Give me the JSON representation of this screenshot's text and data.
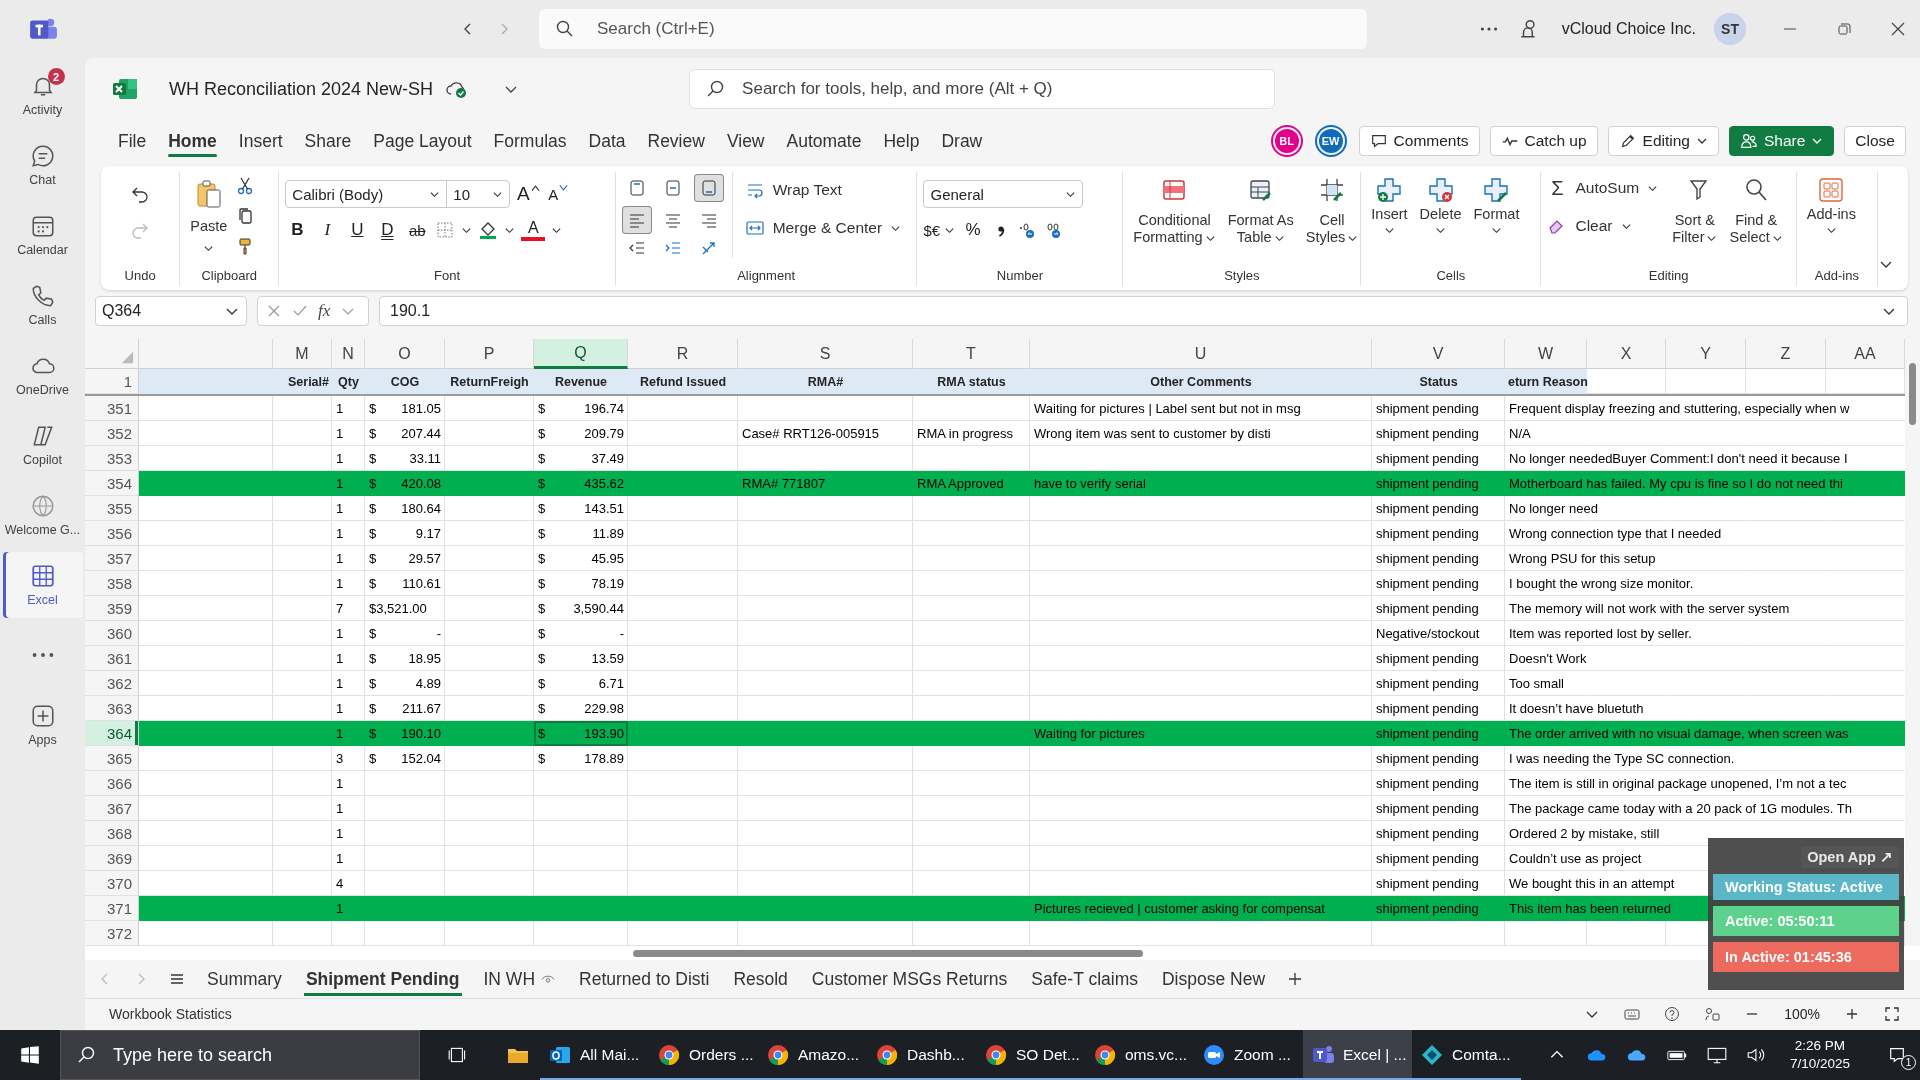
{
  "teams_bar": {
    "search_placeholder": "Search (Ctrl+E)",
    "organization": "vCloud Choice Inc.",
    "user_initials": "ST"
  },
  "rail": [
    {
      "kind": "activity",
      "label": "Activity",
      "badge": "2",
      "selected": false
    },
    {
      "kind": "chat",
      "label": "Chat",
      "selected": false
    },
    {
      "kind": "calendar",
      "label": "Calendar",
      "selected": false
    },
    {
      "kind": "calls",
      "label": "Calls",
      "selected": false
    },
    {
      "kind": "onedrive",
      "label": "OneDrive",
      "selected": false
    },
    {
      "kind": "copilot",
      "label": "Copilot",
      "selected": false
    },
    {
      "kind": "welcome",
      "label": "Welcome G...",
      "selected": false
    },
    {
      "kind": "excel",
      "label": "Excel",
      "selected": true
    },
    {
      "kind": "more",
      "selected": false
    },
    {
      "kind": "apps",
      "label": "Apps",
      "selected": false
    }
  ],
  "workbook": {
    "title": "WH Reconciliation 2024 New-SH",
    "search_placeholder": "Search for tools, help, and more (Alt + Q)"
  },
  "menu_tabs": [
    {
      "label": "File",
      "selected": false
    },
    {
      "label": "Home",
      "selected": true
    },
    {
      "label": "Insert",
      "selected": false
    },
    {
      "label": "Share",
      "selected": false
    },
    {
      "label": "Page Layout",
      "selected": false
    },
    {
      "label": "Formulas",
      "selected": false
    },
    {
      "label": "Data",
      "selected": false
    },
    {
      "label": "Review",
      "selected": false
    },
    {
      "label": "View",
      "selected": false
    },
    {
      "label": "Automate",
      "selected": false
    },
    {
      "label": "Help",
      "selected": false
    },
    {
      "label": "Draw",
      "selected": false
    }
  ],
  "collaborators": [
    {
      "initials": "BL",
      "color": "#e3008c"
    },
    {
      "initials": "EW",
      "color": "#0f6cbd"
    }
  ],
  "actions": [
    {
      "kind": "comments",
      "label": "Comments"
    },
    {
      "kind": "catchup",
      "label": "Catch up"
    },
    {
      "kind": "editing",
      "label": "Editing"
    },
    {
      "kind": "share",
      "label": "Share"
    },
    {
      "kind": "close",
      "label": "Close"
    }
  ],
  "ribbon": {
    "undo_label": "Undo",
    "clipboard": {
      "label": "Clipboard",
      "paste": "Paste"
    },
    "font": {
      "label": "Font",
      "name": "Calibri (Body)",
      "size": "10",
      "grow": "A",
      "shrink": "A",
      "color_letter": "A",
      "styles": [
        {
          "kind": "bold",
          "text": "B"
        },
        {
          "kind": "italic",
          "text": "I"
        },
        {
          "kind": "underline",
          "text": "U"
        },
        {
          "kind": "double_underline",
          "text": "D"
        },
        {
          "kind": "strike",
          "text": "ab"
        }
      ]
    },
    "alignment": {
      "label": "Alignment",
      "vertical": [
        {
          "kind": "top",
          "selected": false
        },
        {
          "kind": "middle",
          "selected": false
        },
        {
          "kind": "bottom",
          "selected": true
        }
      ],
      "horizontal": [
        {
          "kind": "left",
          "selected": true
        },
        {
          "kind": "center",
          "selected": false
        },
        {
          "kind": "right",
          "selected": false
        }
      ],
      "wrap": "Wrap Text",
      "merge": "Merge & Center"
    },
    "number": {
      "label": "Number",
      "format": "General",
      "currency": "$€",
      "percent": "%"
    },
    "styles": {
      "label": "Styles",
      "buttons": [
        {
          "kind": "conditional",
          "lines": [
            "Conditional",
            "Formatting"
          ]
        },
        {
          "kind": "table",
          "lines": [
            "Format As",
            "Table"
          ]
        },
        {
          "kind": "cell_styles",
          "lines": [
            "Cell",
            "Styles"
          ]
        }
      ]
    },
    "cells": {
      "label": "Cells",
      "buttons": [
        {
          "kind": "insert",
          "label": "Insert"
        },
        {
          "kind": "delete",
          "label": "Delete"
        },
        {
          "kind": "format",
          "label": "Format"
        }
      ]
    },
    "editing": {
      "label": "Editing",
      "sigma": "Σ",
      "autosum": "AutoSum",
      "clear": "Clear",
      "buttons": [
        {
          "kind": "sort",
          "lines": [
            "Sort &",
            "Filter"
          ]
        },
        {
          "kind": "find",
          "lines": [
            "Find &",
            "Select"
          ]
        }
      ]
    },
    "addins": {
      "label": "Add-ins",
      "button": "Add-ins"
    }
  },
  "formula_bar": {
    "cell": "Q364",
    "function_label": "fx",
    "formula": "190.1"
  },
  "sheet": {
    "columns": [
      {
        "letter": "M",
        "selected": false
      },
      {
        "letter": "N",
        "selected": false
      },
      {
        "letter": "O",
        "selected": false
      },
      {
        "letter": "P",
        "selected": false
      },
      {
        "letter": "Q",
        "selected": true
      },
      {
        "letter": "R",
        "selected": false
      },
      {
        "letter": "S",
        "selected": false
      },
      {
        "letter": "T",
        "selected": false
      },
      {
        "letter": "U",
        "selected": false
      },
      {
        "letter": "V",
        "selected": false
      },
      {
        "letter": "W",
        "selected": false
      },
      {
        "letter": "X",
        "selected": false
      },
      {
        "letter": "Y",
        "selected": false
      },
      {
        "letter": "Z",
        "selected": false
      },
      {
        "letter": "AA",
        "selected": false
      }
    ],
    "header_row": {
      "number": "1",
      "cells": [
        "Serial#",
        "Qty",
        "COG",
        "ReturnFreigh",
        "Revenue",
        "Refund Issued",
        "RMA#",
        "RMA status",
        "Other Comments",
        "Status",
        "eturn Reason"
      ]
    },
    "rows": [
      {
        "number": "351",
        "selected": false,
        "highlight": false,
        "qty": "1",
        "cog_symbol": "$",
        "cog": "181.05",
        "revenue_symbol": "$",
        "revenue": "196.74",
        "comment": "Waiting for pictures | Label sent but not in msg",
        "status": "shipment pending",
        "reason": "Frequent display freezing and stuttering, especially when w"
      },
      {
        "number": "352",
        "selected": false,
        "highlight": false,
        "qty": "1",
        "cog_symbol": "$",
        "cog": "207.44",
        "revenue_symbol": "$",
        "revenue": "209.79",
        "rma": "Case# RRT126-005915",
        "rma_status": "RMA in progress",
        "comment": "Wrong item was sent to customer by disti",
        "status": "shipment pending",
        "reason": "N/A"
      },
      {
        "number": "353",
        "selected": false,
        "highlight": false,
        "qty": "1",
        "cog_symbol": "$",
        "cog": "33.11",
        "revenue_symbol": "$",
        "revenue": "37.49",
        "status": "shipment pending",
        "reason": "No longer neededBuyer Comment:I don't need it because I"
      },
      {
        "number": "354",
        "selected": false,
        "highlight": true,
        "qty": "1",
        "cog_symbol": "$",
        "cog": "420.08",
        "revenue_symbol": "$",
        "revenue": "435.62",
        "rma": "RMA# 771807",
        "rma_status": "RMA Approved",
        "comment": "have to verify serial",
        "status": "shipment pending",
        "reason": "Motherboard has failed. My cpu is fine so I do not need thi"
      },
      {
        "number": "355",
        "selected": false,
        "highlight": false,
        "qty": "1",
        "cog_symbol": "$",
        "cog": "180.64",
        "revenue_symbol": "$",
        "revenue": "143.51",
        "status": "shipment pending",
        "reason": "No longer need"
      },
      {
        "number": "356",
        "selected": false,
        "highlight": false,
        "qty": "1",
        "cog_symbol": "$",
        "cog": "9.17",
        "revenue_symbol": "$",
        "revenue": "11.89",
        "status": "shipment pending",
        "reason": "Wrong connection type that I needed"
      },
      {
        "number": "357",
        "selected": false,
        "highlight": false,
        "qty": "1",
        "cog_symbol": "$",
        "cog": "29.57",
        "revenue_symbol": "$",
        "revenue": "45.95",
        "status": "shipment pending",
        "reason": "Wrong PSU for this setup"
      },
      {
        "number": "358",
        "selected": false,
        "highlight": false,
        "qty": "1",
        "cog_symbol": "$",
        "cog": "110.61",
        "revenue_symbol": "$",
        "revenue": "78.19",
        "status": "shipment pending",
        "reason": "I bought the wrong size monitor."
      },
      {
        "number": "359",
        "selected": false,
        "highlight": false,
        "qty": "7",
        "cog": "$3,521.00",
        "revenue_symbol": "$",
        "revenue": "3,590.44",
        "status": "shipment pending",
        "reason": "The memory will not work with the server system"
      },
      {
        "number": "360",
        "selected": false,
        "highlight": false,
        "qty": "1",
        "cog_symbol": "$",
        "cog": "-",
        "revenue_symbol": "$",
        "revenue": "-",
        "status": "Negative/stockout",
        "reason": "Item was reported lost by seller."
      },
      {
        "number": "361",
        "selected": false,
        "highlight": false,
        "qty": "1",
        "cog_symbol": "$",
        "cog": "18.95",
        "revenue_symbol": "$",
        "revenue": "13.59",
        "status": "shipment pending",
        "reason": "Doesn't Work"
      },
      {
        "number": "362",
        "selected": false,
        "highlight": false,
        "qty": "1",
        "cog_symbol": "$",
        "cog": "4.89",
        "revenue_symbol": "$",
        "revenue": "6.71",
        "status": "shipment pending",
        "reason": "Too small"
      },
      {
        "number": "363",
        "selected": false,
        "highlight": false,
        "qty": "1",
        "cog_symbol": "$",
        "cog": "211.67",
        "revenue_symbol": "$",
        "revenue": "229.98",
        "status": "shipment pending",
        "reason": "It doesn’t have bluetuth"
      },
      {
        "number": "364",
        "selected": true,
        "highlight": true,
        "qty": "1",
        "cog_symbol": "$",
        "cog": "190.10",
        "revenue_symbol": "$",
        "revenue": "193.90",
        "comment": "Waiting for pictures",
        "status": "shipment pending",
        "reason": "The order arrived with no visual damage, when screen was"
      },
      {
        "number": "365",
        "selected": false,
        "highlight": false,
        "qty": "3",
        "cog_symbol": "$",
        "cog": "152.04",
        "revenue_symbol": "$",
        "revenue": "178.89",
        "status": "shipment pending",
        "reason": "I was needing the Type SC connection."
      },
      {
        "number": "366",
        "selected": false,
        "highlight": false,
        "qty": "1",
        "status": "shipment pending",
        "reason": "The item is still in original package unopened, I’m not a tec"
      },
      {
        "number": "367",
        "selected": false,
        "highlight": false,
        "qty": "1",
        "status": "shipment pending",
        "reason": "The package came today with a 20 pack of 1G modules.  Th"
      },
      {
        "number": "368",
        "selected": false,
        "highlight": false,
        "qty": "1",
        "status": "shipment pending",
        "reason": "Ordered 2 by mistake, still"
      },
      {
        "number": "369",
        "selected": false,
        "highlight": false,
        "qty": "1",
        "status": "shipment pending",
        "reason": "Couldn’t use as project"
      },
      {
        "number": "370",
        "selected": false,
        "highlight": false,
        "qty": "4",
        "status": "shipment pending",
        "reason": "We bought this in an attempt"
      },
      {
        "number": "371",
        "selected": false,
        "highlight": true,
        "qty": "1",
        "comment": "Pictures recieved | customer asking for compensat",
        "status": "shipment pending",
        "reason": "This item has been returned"
      },
      {
        "number": "372",
        "selected": false,
        "highlight": false
      }
    ]
  },
  "sheet_tabs": [
    {
      "label": "Summary",
      "selected": false,
      "watched": false
    },
    {
      "label": "Shipment Pending",
      "selected": true,
      "watched": false
    },
    {
      "label": "IN WH",
      "selected": false,
      "watched": true
    },
    {
      "label": "Returned to Disti",
      "selected": false,
      "watched": false
    },
    {
      "label": "Resold",
      "selected": false,
      "watched": false
    },
    {
      "label": "Customer MSGs Returns",
      "selected": false,
      "watched": false
    },
    {
      "label": "Safe-T claims",
      "selected": false,
      "watched": false
    },
    {
      "label": "Dispose New",
      "selected": false,
      "watched": false
    }
  ],
  "status_bar": {
    "left": "Workbook Statistics",
    "zoom": "100%"
  },
  "tracker": {
    "button": "Open App ↗",
    "status": "Working Status: Active",
    "active": "Active: 05:50:11",
    "inactive": "In Active: 01:45:36"
  },
  "taskbar": {
    "search_placeholder": "Type here to search",
    "apps": [
      {
        "kind": "outlook",
        "label": "All Mai...",
        "selected": false
      },
      {
        "kind": "chrome",
        "label": "Orders ...",
        "selected": false
      },
      {
        "kind": "chrome",
        "label": "Amazo...",
        "selected": false
      },
      {
        "kind": "chrome",
        "label": "Dashb...",
        "selected": false
      },
      {
        "kind": "chrome",
        "label": "SO Det...",
        "selected": false
      },
      {
        "kind": "chrome",
        "label": "oms.vc...",
        "selected": false
      },
      {
        "kind": "zoom",
        "label": "Zoom ...",
        "selected": false
      },
      {
        "kind": "teams",
        "label": "Excel | ...",
        "selected": true
      },
      {
        "kind": "comta",
        "label": "Comta...",
        "selected": false
      }
    ],
    "time": "2:26 PM",
    "date": "7/10/2025",
    "notifications": "1"
  }
}
